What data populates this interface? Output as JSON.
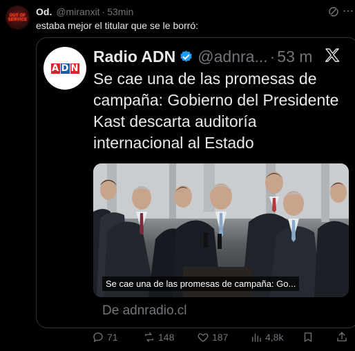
{
  "tweet": {
    "author_name": "Od.",
    "author_handle": "@miranxit",
    "time": "53min",
    "text": "estaba mejor el titular que se le borró:",
    "avatar_text": "OUT OF SERVICE"
  },
  "quoted": {
    "name": "Radio ADN",
    "handle": "@adnra...",
    "time": "53 m",
    "title": "Se cae una de las promesas de campaña: Gobierno del Presidente Kast descarta auditoría internacional al Estado",
    "logo_letters": [
      "A",
      "D",
      "N"
    ],
    "logo_colors": [
      "#d7232b",
      "#1e5aa8",
      "#d7232b"
    ],
    "photo_caption": "Se cae una de las promesas de campaña: Go...",
    "domain": "De adnradio.cl"
  },
  "actions": {
    "replies": "71",
    "reposts": "148",
    "likes": "187",
    "views": "4,8k"
  },
  "colors": {
    "background": "#000000",
    "text": "#e7e9ea",
    "muted": "#71767b",
    "verified": "#1d9bf0",
    "border": "#2f3336"
  }
}
